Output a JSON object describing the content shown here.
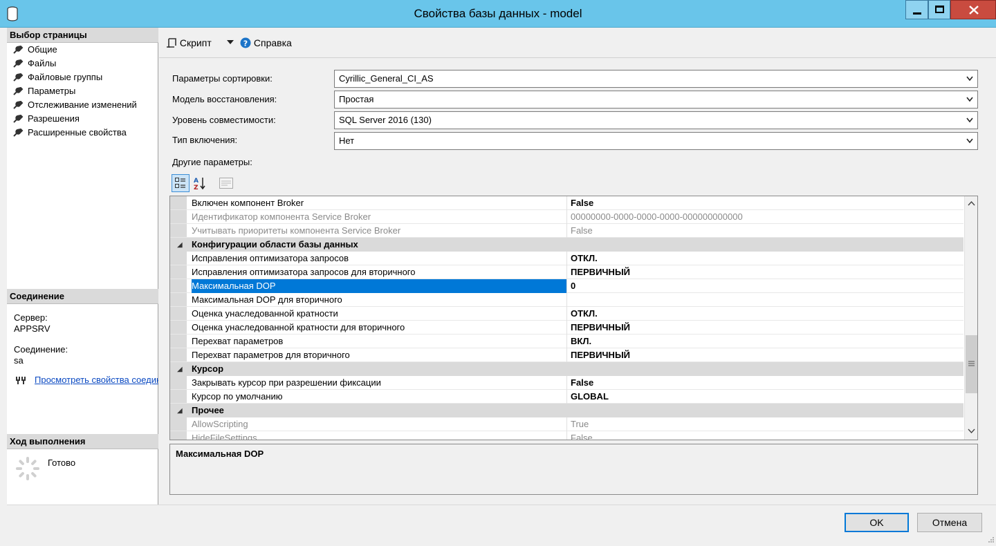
{
  "window": {
    "title": "Свойства базы данных - model",
    "icon": "database-icon"
  },
  "left": {
    "select_page_header": "Выбор страницы",
    "pages": [
      {
        "label": "Общие"
      },
      {
        "label": "Файлы"
      },
      {
        "label": "Файловые группы"
      },
      {
        "label": "Параметры"
      },
      {
        "label": "Отслеживание изменений"
      },
      {
        "label": "Разрешения"
      },
      {
        "label": "Расширенные свойства"
      }
    ],
    "connection_header": "Соединение",
    "server_label": "Сервер:",
    "server_value": "APPSRV",
    "connection_label": "Соединение:",
    "connection_value": "sa",
    "view_props_link": "Просмотреть свойства соединения",
    "progress_header": "Ход выполнения",
    "progress_status": "Готово"
  },
  "toolbar": {
    "script_label": "Скрипт",
    "help_label": "Справка"
  },
  "form": {
    "collation_label": "Параметры сортировки:",
    "collation_value": "Cyrillic_General_CI_AS",
    "recovery_label": "Модель восстановления:",
    "recovery_value": "Простая",
    "compat_label": "Уровень совместимости:",
    "compat_value": "SQL Server 2016 (130)",
    "containment_label": "Тип включения:",
    "containment_value": "Нет",
    "other_label": "Другие параметры:"
  },
  "grid": {
    "rows": [
      {
        "kind": "item",
        "style": "bold",
        "name": "Включен компонент Broker",
        "value": "False"
      },
      {
        "kind": "item",
        "style": "dim",
        "name": "Идентификатор компонента Service Broker",
        "value": "00000000-0000-0000-0000-000000000000"
      },
      {
        "kind": "item",
        "style": "dim",
        "name": "Учитывать приоритеты компонента Service Broker",
        "value": "False"
      },
      {
        "kind": "cat",
        "name": "Конфигурации области базы данных",
        "value": ""
      },
      {
        "kind": "item",
        "style": "bold",
        "name": "Исправления оптимизатора запросов",
        "value": "ОТКЛ."
      },
      {
        "kind": "item",
        "style": "bold",
        "name": "Исправления оптимизатора запросов для вторичного",
        "value": "ПЕРВИЧНЫЙ"
      },
      {
        "kind": "item",
        "style": "bold selected",
        "name": "Максимальная DOP",
        "value": "0"
      },
      {
        "kind": "item",
        "style": "bold",
        "name": "Максимальная DOP для вторичного",
        "value": ""
      },
      {
        "kind": "item",
        "style": "bold",
        "name": "Оценка унаследованной кратности",
        "value": "ОТКЛ."
      },
      {
        "kind": "item",
        "style": "bold",
        "name": "Оценка унаследованной кратности для вторичного",
        "value": "ПЕРВИЧНЫЙ"
      },
      {
        "kind": "item",
        "style": "bold",
        "name": "Перехват параметров",
        "value": "ВКЛ."
      },
      {
        "kind": "item",
        "style": "bold",
        "name": "Перехват параметров для вторичного",
        "value": "ПЕРВИЧНЫЙ"
      },
      {
        "kind": "cat",
        "name": "Курсор",
        "value": ""
      },
      {
        "kind": "item",
        "style": "bold",
        "name": "Закрывать курсор при разрешении фиксации",
        "value": "False"
      },
      {
        "kind": "item",
        "style": "bold",
        "name": "Курсор по умолчанию",
        "value": "GLOBAL"
      },
      {
        "kind": "cat",
        "name": "Прочее",
        "value": ""
      },
      {
        "kind": "item",
        "style": "dim",
        "name": "AllowScripting",
        "value": "True"
      },
      {
        "kind": "item",
        "style": "dim",
        "name": "HideFileSettings",
        "value": "False"
      }
    ]
  },
  "description": {
    "title": "Максимальная DOP"
  },
  "buttons": {
    "ok": "OK",
    "cancel": "Отмена"
  }
}
